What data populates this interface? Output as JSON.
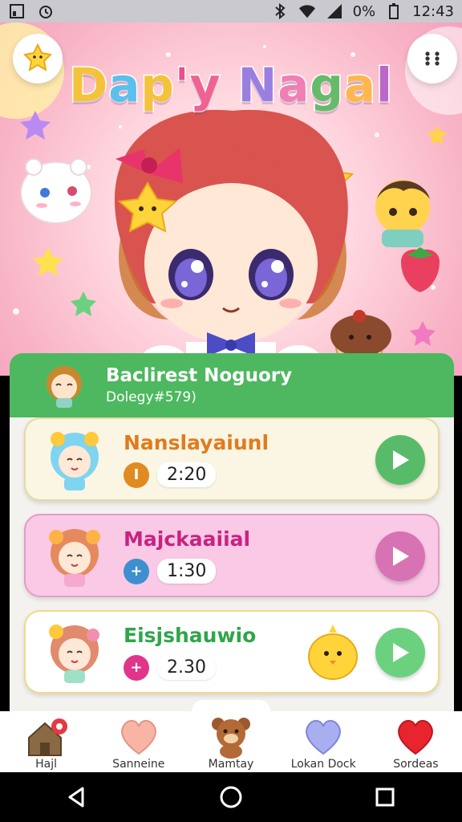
{
  "status_bar": {
    "battery": "0%",
    "time": "12:43"
  },
  "hero": {
    "title": "Dap'y Nagal",
    "title_colors": [
      "#f5c33b",
      "#5bc0eb",
      "#f5c33b",
      "#e94f8a",
      "#f06292",
      "#9b7fe0",
      "#ef7fb4",
      "#66bb6a",
      "#ffb74d",
      "#ba68c8"
    ]
  },
  "playlist": {
    "title": "Baclirest Noguory",
    "subtitle": "Dolegy#579)",
    "header_color": "#4db85f",
    "tracks": [
      {
        "name": "Nanslayaiunl",
        "badge": "I",
        "duration": "2:20",
        "card_bg": "#fbf6e3",
        "name_color": "#e07b1f",
        "badge_color": "#e08a22",
        "play_color": "#58bb6a"
      },
      {
        "name": "Majckaaiial",
        "badge": "+",
        "duration": "1:30",
        "card_bg": "#f9c9e6",
        "name_color": "#c72382",
        "badge_color": "#3d8fd0",
        "play_color": "#d772b4"
      },
      {
        "name": "Eisjshauwio",
        "badge": "+",
        "duration": "2.30",
        "card_bg": "#ffffff",
        "name_color": "#2fa64a",
        "badge_color": "#e0358b",
        "play_color": "#6bd17f"
      }
    ]
  },
  "bottom_nav": [
    {
      "label": "Hajl",
      "icon": "home-icon"
    },
    {
      "label": "Sanneine",
      "icon": "peach-heart-icon"
    },
    {
      "label": "Mamtay",
      "icon": "bear-icon"
    },
    {
      "label": "Lokan Dock",
      "icon": "lavender-heart-icon"
    },
    {
      "label": "Sordeas",
      "icon": "red-heart-icon"
    }
  ]
}
